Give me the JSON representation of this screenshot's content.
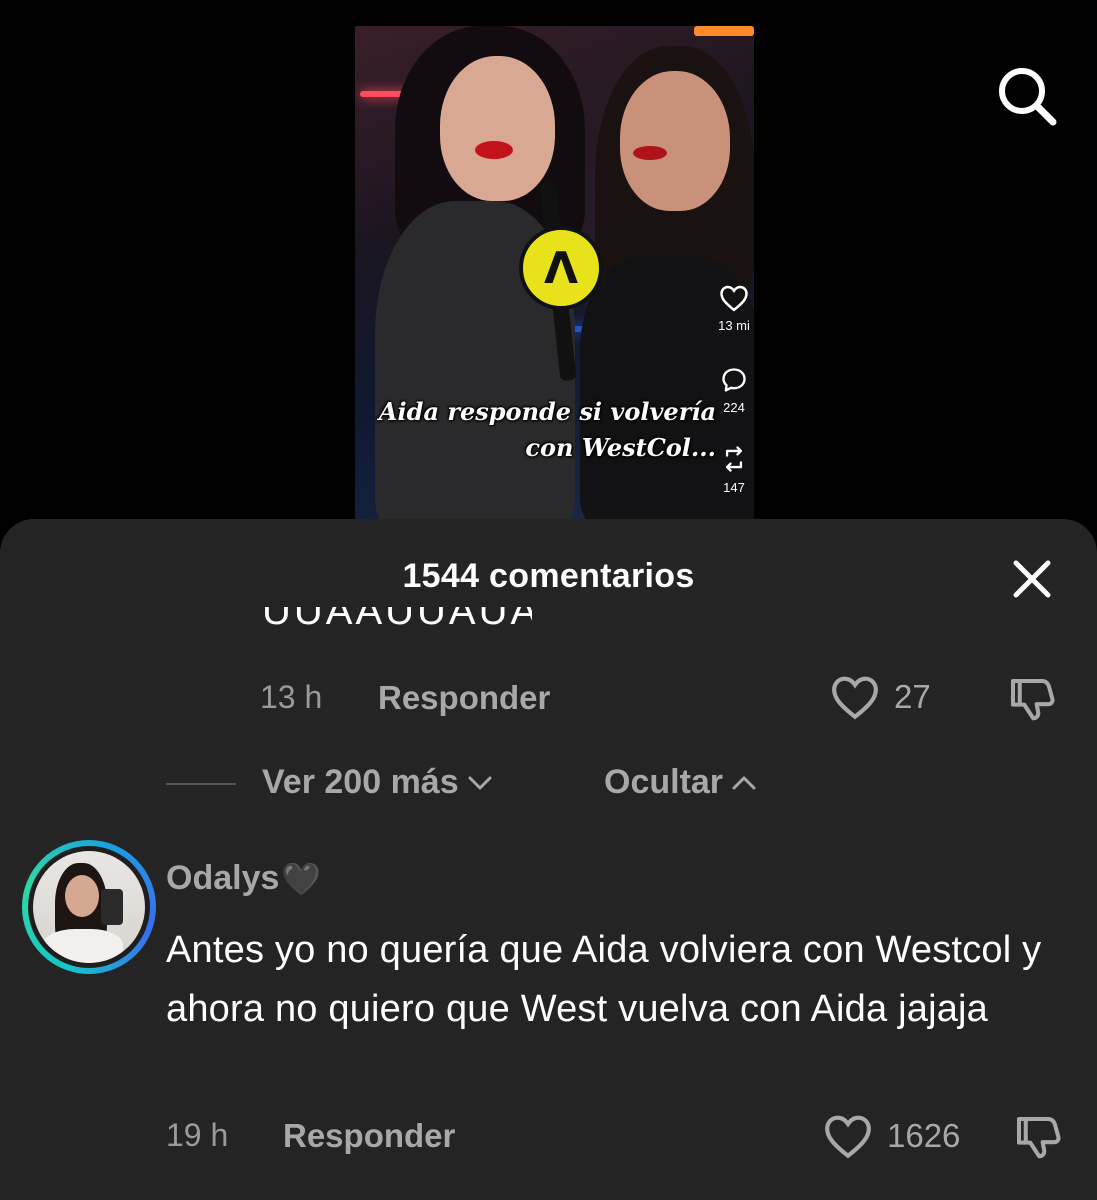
{
  "video": {
    "caption_line1": "Aida responde si volvería",
    "caption_line2": "con WestCol...",
    "likes": "13 mi",
    "comments": "224",
    "reposts": "147"
  },
  "header": {
    "search_icon": "search-icon"
  },
  "sheet": {
    "title": "1544 comentarios",
    "close_icon": "close-icon"
  },
  "previous_comment": {
    "cut_text": "UUAAUUAUAA",
    "time": "13 h",
    "reply_label": "Responder",
    "likes": "27"
  },
  "replies": {
    "more_label": "Ver 200 más",
    "hide_label": "Ocultar"
  },
  "comment": {
    "username": "Odalys",
    "username_emoji": "🖤",
    "text": "Antes yo no quería que Aida volviera con Westcol y ahora no quiero que West vuelva con Aida jajaja",
    "time": "19 h",
    "reply_label": "Responder",
    "likes": "1626"
  },
  "colors": {
    "sheet_bg": "#242424",
    "muted_text": "#a8a8a8",
    "avatar_ring": "#16c6c6"
  }
}
